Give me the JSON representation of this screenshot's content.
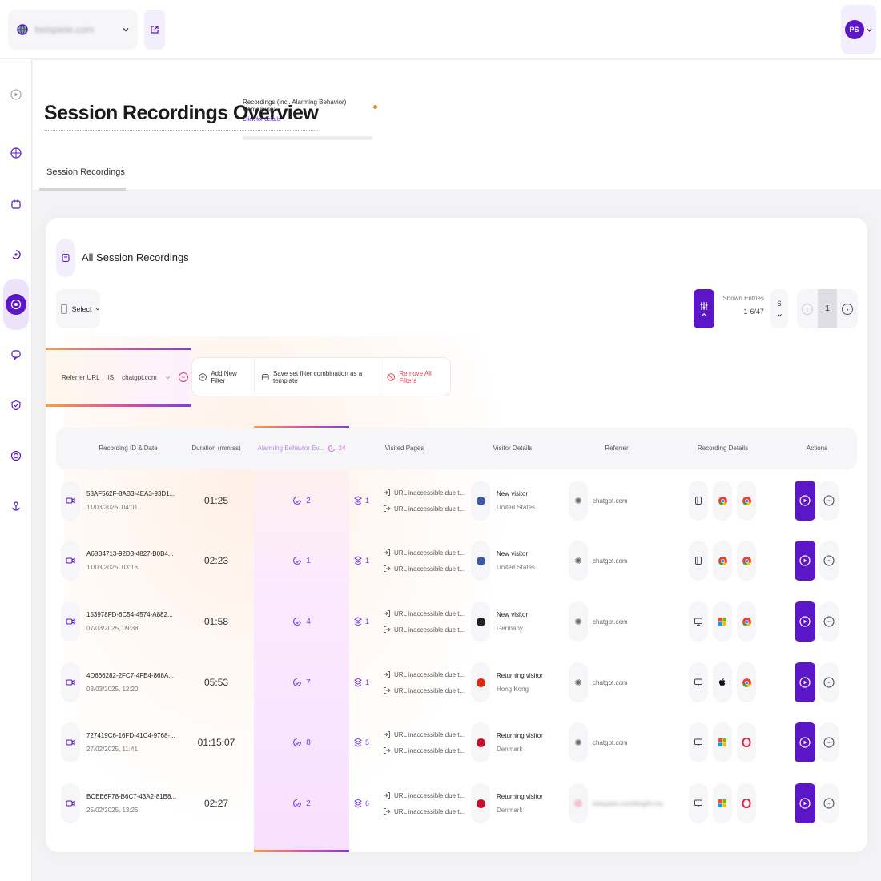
{
  "topbar": {
    "site_name": "beispiele.com",
    "user_initials": "PS",
    "site_icon": "globe-icon",
    "external_icon": "external-link-icon"
  },
  "sidebar": {
    "items": [
      {
        "icon": "play-circle-icon",
        "active": false
      },
      {
        "icon": "chart-icon",
        "active": false
      },
      {
        "icon": "calendar-icon",
        "active": false
      },
      {
        "icon": "funnel-icon",
        "active": false
      },
      {
        "icon": "eye-recording-icon",
        "active": true
      },
      {
        "icon": "chat-icon",
        "active": false
      },
      {
        "icon": "shield-icon",
        "active": false
      },
      {
        "icon": "target-icon",
        "active": false
      },
      {
        "icon": "anchor-icon",
        "active": false
      }
    ]
  },
  "header": {
    "title": "Session Recordings Overview",
    "quota_label": "Recordings (incl. Alarming Behavior) Remaining:",
    "quota_link": "Click for details",
    "tab": "Session Recordings"
  },
  "panel": {
    "title": "All Session Recordings",
    "select_label": "Select",
    "shown_entries_label": "Shown Entries",
    "shown_entries_value": "1-6/47",
    "entries_per_page": "6",
    "current_page": "1"
  },
  "filters": {
    "active_filter": {
      "field": "Referrer URL",
      "operator": "IS",
      "value": "chatgpt.com"
    },
    "add_new": "Add New Filter",
    "save_template": "Save set filter combination as a template",
    "remove_all": "Remove All Filters"
  },
  "table": {
    "headers": [
      "Recording ID & Date",
      "Duration (mm:ss)",
      "Alarming Behavior Ev...",
      "Visited Pages",
      "Visitor Details",
      "Referrer",
      "Recording Details",
      "Actions"
    ],
    "alarm_header_count": "24",
    "rows": [
      {
        "id": "53AF562F-8AB3-4EA3-93D1...",
        "date": "11/03/2025, 04:01",
        "duration": "01:25",
        "alarms": "2",
        "pages": "1",
        "url1": "URL inaccessible due t...",
        "url2": "URL inaccessible due t...",
        "visitor_type": "New visitor",
        "country": "United States",
        "flag": "#3c5aa8",
        "referrer": "chatgpt.com",
        "device": "tablet-icon",
        "os": "chrome-icon",
        "browser": "chrome-icon"
      },
      {
        "id": "A68B4713-92D3-4827-B0B4...",
        "date": "11/03/2025, 03:16",
        "duration": "02:23",
        "alarms": "1",
        "pages": "1",
        "url1": "URL inaccessible due t...",
        "url2": "URL inaccessible due t...",
        "visitor_type": "New visitor",
        "country": "United States",
        "flag": "#3c5aa8",
        "referrer": "chatgpt.com",
        "device": "tablet-icon",
        "os": "chrome-icon",
        "browser": "chrome-icon"
      },
      {
        "id": "153978FD-6C54-4574-A882...",
        "date": "07/03/2025, 09:38",
        "duration": "01:58",
        "alarms": "4",
        "pages": "1",
        "url1": "URL inaccessible due t...",
        "url2": "URL inaccessible due t...",
        "visitor_type": "New visitor",
        "country": "Germany",
        "flag": "#222222",
        "referrer": "chatgpt.com",
        "device": "desktop-icon",
        "os": "windows-icon",
        "browser": "chrome-icon"
      },
      {
        "id": "4D666282-2FC7-4FE4-868A...",
        "date": "03/03/2025, 12:20",
        "duration": "05:53",
        "alarms": "7",
        "pages": "1",
        "url1": "URL inaccessible due t...",
        "url2": "URL inaccessible due t...",
        "visitor_type": "Returning visitor",
        "country": "Hong Kong",
        "flag": "#de2910",
        "referrer": "chatgpt.com",
        "device": "desktop-icon",
        "os": "apple-icon",
        "browser": "chrome-icon"
      },
      {
        "id": "727419C6-16FD-41C4-9768-...",
        "date": "27/02/2025, 11:41",
        "duration": "01:15:07",
        "alarms": "8",
        "pages": "5",
        "url1": "URL inaccessible due t...",
        "url2": "URL inaccessible due t...",
        "visitor_type": "Returning visitor",
        "country": "Denmark",
        "flag": "#c8102e",
        "referrer": "chatgpt.com",
        "device": "desktop-icon",
        "os": "windows-icon",
        "browser": "opera-icon"
      },
      {
        "id": "BCEE6F78-B6C7-43A2-81B8...",
        "date": "25/02/2025, 13:25",
        "duration": "02:27",
        "alarms": "2",
        "pages": "6",
        "url1": "URL inaccessible due t...",
        "url2": "URL inaccessible due t...",
        "visitor_type": "Returning visitor",
        "country": "Denmark",
        "flag": "#c8102e",
        "referrer": "beispiele.com/blog/hi-my",
        "referrer_blurred": true,
        "device": "desktop-icon",
        "os": "windows-icon",
        "browser": "opera-icon"
      }
    ]
  },
  "colors": {
    "accent": "#5b17c7",
    "alarm": "#7b3fe4",
    "danger": "#e0455a"
  }
}
